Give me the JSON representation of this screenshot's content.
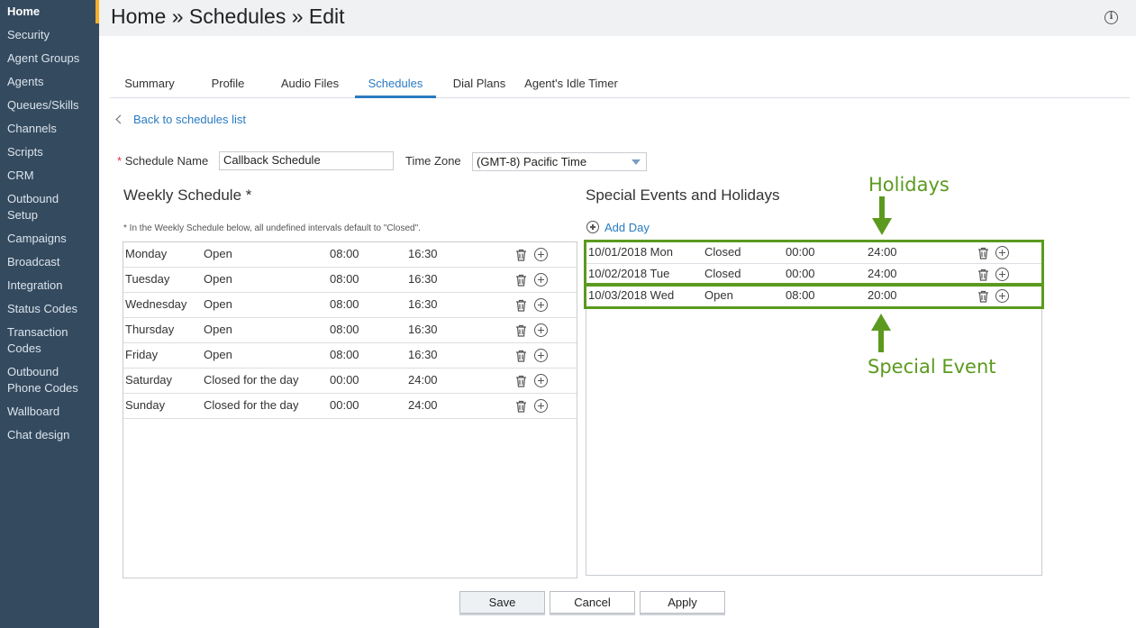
{
  "sidebar": {
    "items": [
      {
        "label": "Home",
        "active": true
      },
      {
        "label": "Security"
      },
      {
        "label": "Agent Groups"
      },
      {
        "label": "Agents"
      },
      {
        "label": "Queues/Skills"
      },
      {
        "label": "Channels"
      },
      {
        "label": "Scripts"
      },
      {
        "label": "CRM"
      },
      {
        "label": "Outbound",
        "label2": "Setup"
      },
      {
        "label": "Campaigns"
      },
      {
        "label": "Broadcast"
      },
      {
        "label": "Integration"
      },
      {
        "label": "Status Codes"
      },
      {
        "label": "Transaction",
        "label2": "Codes"
      },
      {
        "label": "Outbound",
        "label2": "Phone Codes"
      },
      {
        "label": "Wallboard"
      },
      {
        "label": "Chat design"
      }
    ]
  },
  "header": {
    "title": "Home » Schedules » Edit",
    "info_icon": "info-icon"
  },
  "tabs": [
    {
      "label": "Summary"
    },
    {
      "label": "Profile"
    },
    {
      "label": "Audio Files"
    },
    {
      "label": "Schedules",
      "active": true
    },
    {
      "label": "Dial Plans"
    },
    {
      "label": "Agent's Idle Timer"
    }
  ],
  "back_link": "Back to schedules list",
  "form": {
    "schedule_name_label": "Schedule Name",
    "required_mark": "*",
    "schedule_name_value": "Callback Schedule",
    "time_zone_label": "Time Zone",
    "time_zone_value": "(GMT-8) Pacific Time"
  },
  "weekly": {
    "title": "Weekly Schedule *",
    "note": "* In the Weekly Schedule below, all undefined intervals default to \"Closed\".",
    "rows": [
      {
        "day": "Monday",
        "status": "Open",
        "start": "08:00",
        "end": "16:30"
      },
      {
        "day": "Tuesday",
        "status": "Open",
        "start": "08:00",
        "end": "16:30"
      },
      {
        "day": "Wednesday",
        "status": "Open",
        "start": "08:00",
        "end": "16:30"
      },
      {
        "day": "Thursday",
        "status": "Open",
        "start": "08:00",
        "end": "16:30"
      },
      {
        "day": "Friday",
        "status": "Open",
        "start": "08:00",
        "end": "16:30"
      },
      {
        "day": "Saturday",
        "status": "Closed for the day",
        "start": "00:00",
        "end": "24:00"
      },
      {
        "day": "Sunday",
        "status": "Closed for the day",
        "start": "00:00",
        "end": "24:00"
      }
    ]
  },
  "special": {
    "title": "Special Events and Holidays",
    "add_day": "Add Day",
    "rows": [
      {
        "date": "10/01/2018 Mon",
        "status": "Closed",
        "start": "00:00",
        "end": "24:00"
      },
      {
        "date": "10/02/2018 Tue",
        "status": "Closed",
        "start": "00:00",
        "end": "24:00"
      },
      {
        "date": "10/03/2018 Wed",
        "status": "Open",
        "start": "08:00",
        "end": "20:00"
      }
    ]
  },
  "annotations": {
    "holidays": "Holidays",
    "special_event": "Special Event",
    "color": "#5b9a1f"
  },
  "buttons": {
    "save": "Save",
    "cancel": "Cancel",
    "apply": "Apply"
  },
  "colors": {
    "sidebar": "#344a5f",
    "accent": "#f3b028",
    "link": "#2a7bc0"
  }
}
